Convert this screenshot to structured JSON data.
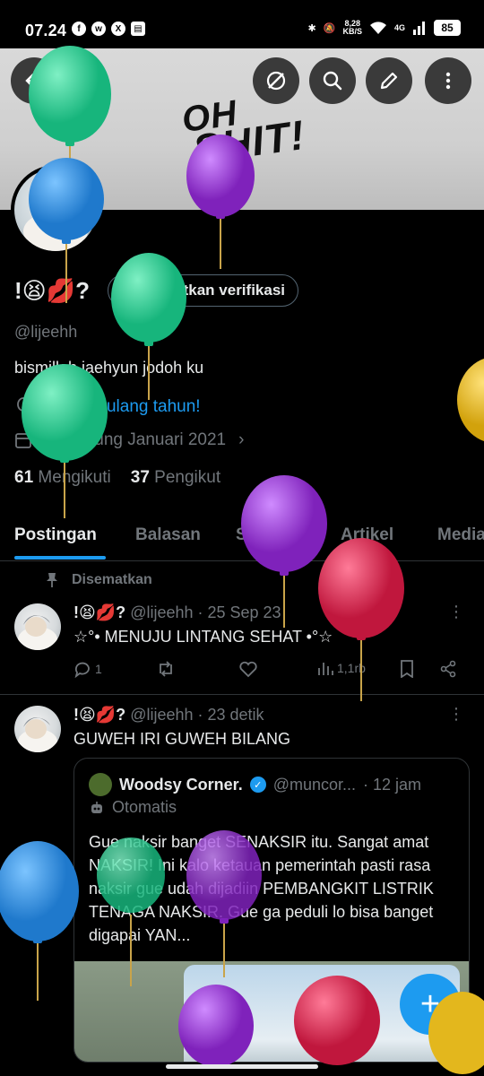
{
  "status_bar": {
    "time": "07.24",
    "net_speed_top": "8,28",
    "net_speed_bottom": "KB/S",
    "network": "4G",
    "battery": "85"
  },
  "banner": {
    "line1": "OH",
    "line2": "SHIT!"
  },
  "profile": {
    "display_name": "!😫💋?",
    "verify_label": "Dapatkan verifikasi",
    "handle": "@lijeehh",
    "bio": "bismillah jaehyun jodoh ku",
    "birthday": "Selamat ulang tahun!",
    "joined": "Bergabung Januari 2021",
    "following_count": "61",
    "following_label": "Mengikuti",
    "followers_count": "37",
    "followers_label": "Pengikut"
  },
  "tabs": [
    "Postingan",
    "Balasan",
    "Sorotan",
    "Artikel",
    "Media"
  ],
  "posts": {
    "pinned_label": "Disematkan",
    "p1": {
      "name": "!😫💋?",
      "meta": "@lijeehh · 25 Sep 23",
      "text": "☆°• MENUJU LINTANG SEHAT •°☆",
      "replies": "1",
      "views": "1,1rb"
    },
    "p2": {
      "name": "!😫💋?",
      "meta": "@lijeehh · 23 detik",
      "text": "GUWEH IRI GUWEH BILANG"
    },
    "quote": {
      "name": "Woodsy Corner.",
      "handle": "@muncor...",
      "time": "· 12 jam",
      "automated": "Otomatis",
      "body": "Gue naksir banget SENAKSIR itu. Sangat amat NAKSIR! Ini kalo ketauan pemerintah pasti rasa naksir gue udah dijadiin PEMBANGKIT LISTRIK TENAGA NAKSIR. Gue ga peduli lo bisa banget digapai YAN..."
    }
  },
  "fab_icon": "+",
  "colors": {
    "accent": "#1d9bf0",
    "background": "#000000",
    "muted": "#71767b",
    "balloon_green": "#27c88f",
    "balloon_blue": "#2b8fe0",
    "balloon_purple": "#9b3ad6",
    "balloon_red": "#d8284f",
    "balloon_yellow": "#e3b71d"
  }
}
